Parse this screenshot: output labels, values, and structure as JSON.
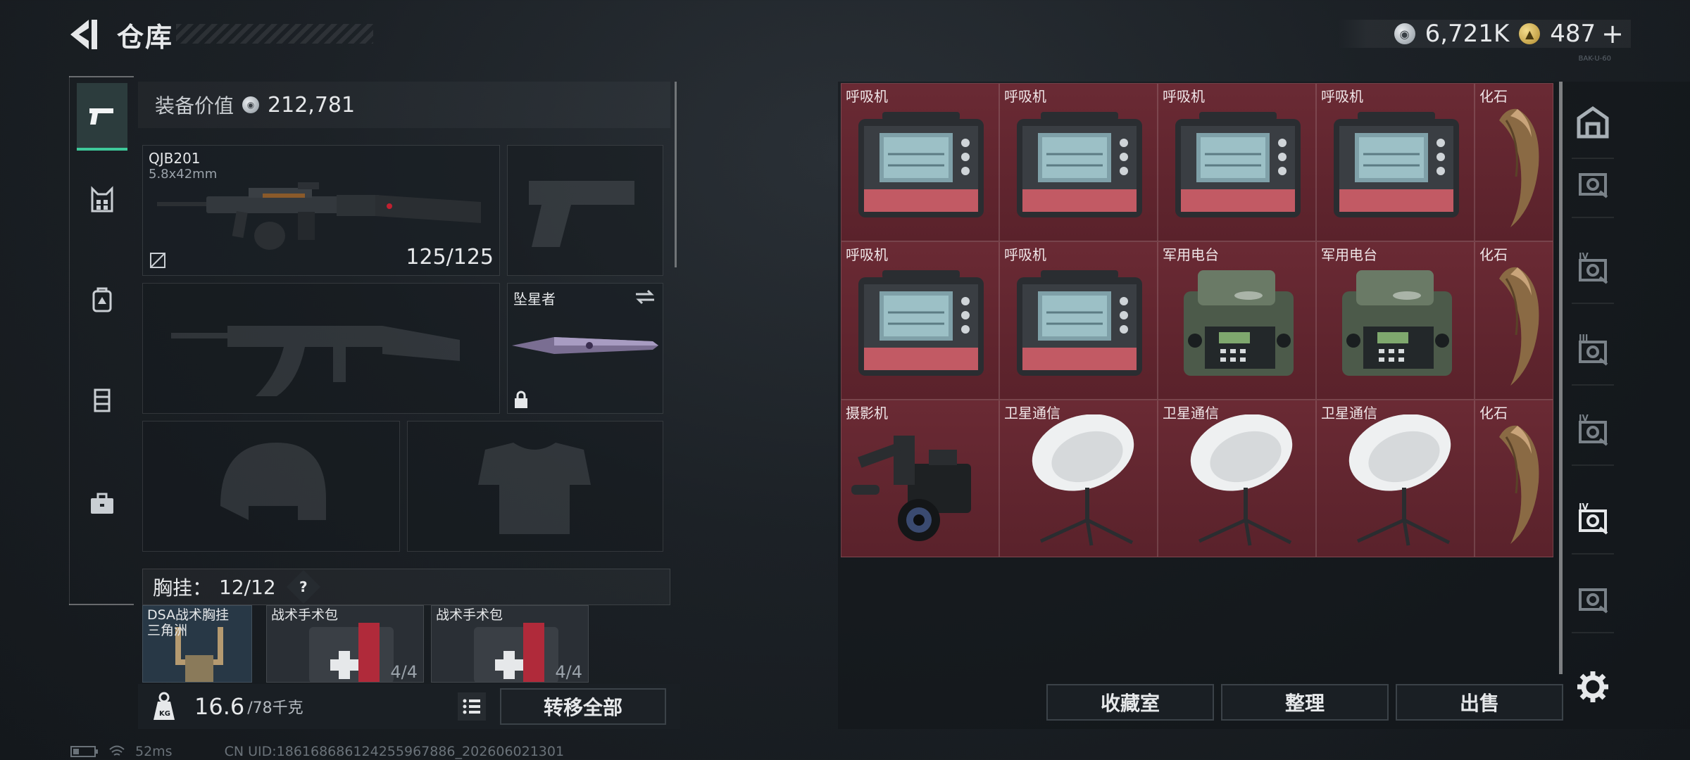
{
  "header": {
    "title": "仓库",
    "currency_silver": "6,721K",
    "currency_gold": "487",
    "plus": "+",
    "mini_tag": "BAK-U-60"
  },
  "left_rail": {
    "items": [
      {
        "icon": "pistol-icon",
        "active": true
      },
      {
        "icon": "vest-icon",
        "active": false
      },
      {
        "icon": "backpack-icon",
        "active": false
      },
      {
        "icon": "rig-icon",
        "active": false
      },
      {
        "icon": "case-icon",
        "active": false
      }
    ]
  },
  "equipment": {
    "value_label": "装备价值",
    "value": "212,781",
    "primary_weapon": {
      "name": "QJB201",
      "caliber": "5.8x42mm",
      "ammo": "125/125"
    },
    "melee": {
      "name": "坠星者"
    },
    "chest_label": "胸挂：",
    "chest_count": "12/12",
    "help": "?",
    "chest_items": [
      {
        "name": "DSA战术胸挂\n三角洲",
        "count": ""
      },
      {
        "name": "战术手术包",
        "count": "4/4"
      },
      {
        "name": "战术手术包",
        "count": "4/4"
      }
    ]
  },
  "footer": {
    "weight": "16.6",
    "weight_cap": "/78千克",
    "transfer_all": "转移全部"
  },
  "storage": {
    "cells": [
      {
        "label": "呼吸机",
        "kind": "ventilator"
      },
      {
        "label": "呼吸机",
        "kind": "ventilator"
      },
      {
        "label": "呼吸机",
        "kind": "ventilator"
      },
      {
        "label": "呼吸机",
        "kind": "ventilator"
      },
      {
        "label": "化石",
        "kind": "fossil"
      },
      {
        "label": "呼吸机",
        "kind": "ventilator"
      },
      {
        "label": "呼吸机",
        "kind": "ventilator"
      },
      {
        "label": "军用电台",
        "kind": "radio"
      },
      {
        "label": "军用电台",
        "kind": "radio"
      },
      {
        "label": "化石",
        "kind": "fossil"
      },
      {
        "label": "摄影机",
        "kind": "camera"
      },
      {
        "label": "卫星通信",
        "kind": "satellite"
      },
      {
        "label": "卫星通信",
        "kind": "satellite"
      },
      {
        "label": "卫星通信",
        "kind": "satellite"
      },
      {
        "label": "化石",
        "kind": "fossil"
      }
    ]
  },
  "actions": {
    "collection": "收藏室",
    "organize": "整理",
    "sell": "出售"
  },
  "right_rail": {
    "items": [
      {
        "icon": "vault-icon",
        "roman": ""
      },
      {
        "icon": "storage-tab-icon",
        "roman": ""
      },
      {
        "icon": "storage-tab-icon",
        "roman": "IV"
      },
      {
        "icon": "storage-tab-icon",
        "roman": "III"
      },
      {
        "icon": "storage-tab-icon",
        "roman": "IV"
      },
      {
        "icon": "storage-tab-icon",
        "roman": "IV"
      },
      {
        "icon": "storage-tab-icon",
        "roman": ""
      },
      {
        "icon": "gear-icon",
        "roman": ""
      }
    ]
  },
  "status": {
    "ping": "52ms",
    "uid": "CN UID:1861686861242559678​86_202606021301"
  }
}
